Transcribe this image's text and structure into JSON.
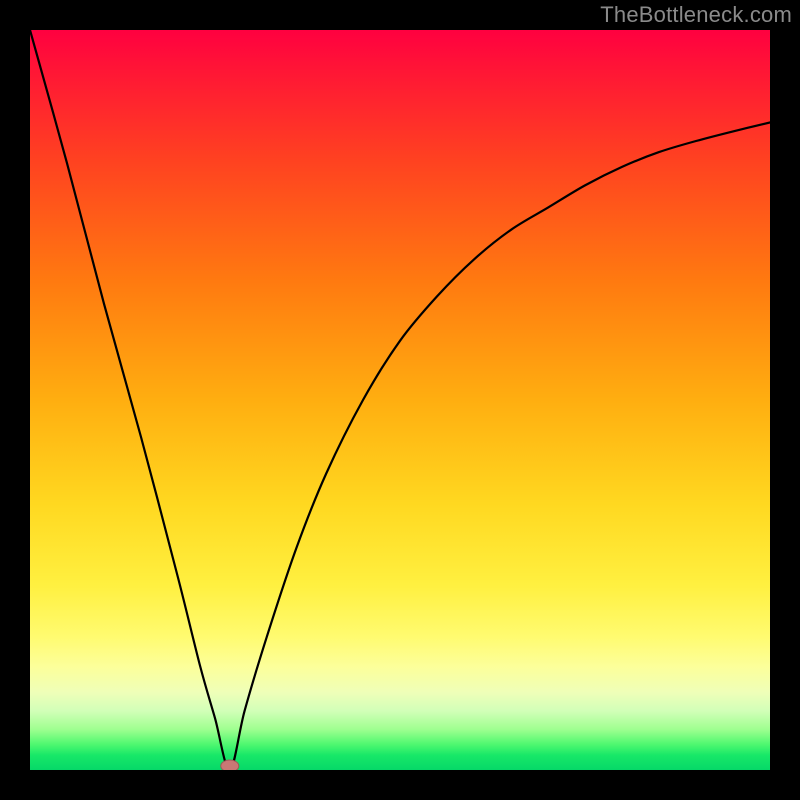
{
  "watermark": {
    "text": "TheBottleneck.com"
  },
  "colors": {
    "frame": "#000000",
    "curve_stroke": "#000000",
    "marker_fill": "#c97875",
    "marker_stroke": "#9a5a57"
  },
  "chart_data": {
    "type": "line",
    "title": "",
    "xlabel": "",
    "ylabel": "",
    "xlim": [
      0,
      100
    ],
    "ylim": [
      0,
      100
    ],
    "grid": false,
    "legend": false,
    "optimum_x": 27,
    "marker": {
      "x": 27,
      "y": 0
    },
    "series": [
      {
        "name": "bottleneck-curve",
        "x": [
          0,
          5,
          10,
          15,
          20,
          23,
          25,
          27,
          29,
          32,
          36,
          40,
          45,
          50,
          55,
          60,
          65,
          70,
          75,
          80,
          85,
          90,
          95,
          100
        ],
        "values": [
          100,
          82,
          63,
          45,
          26,
          14,
          7,
          0,
          8,
          18,
          30,
          40,
          50,
          58,
          64,
          69,
          73,
          76,
          79,
          81.5,
          83.5,
          85,
          86.3,
          87.5
        ]
      }
    ]
  }
}
